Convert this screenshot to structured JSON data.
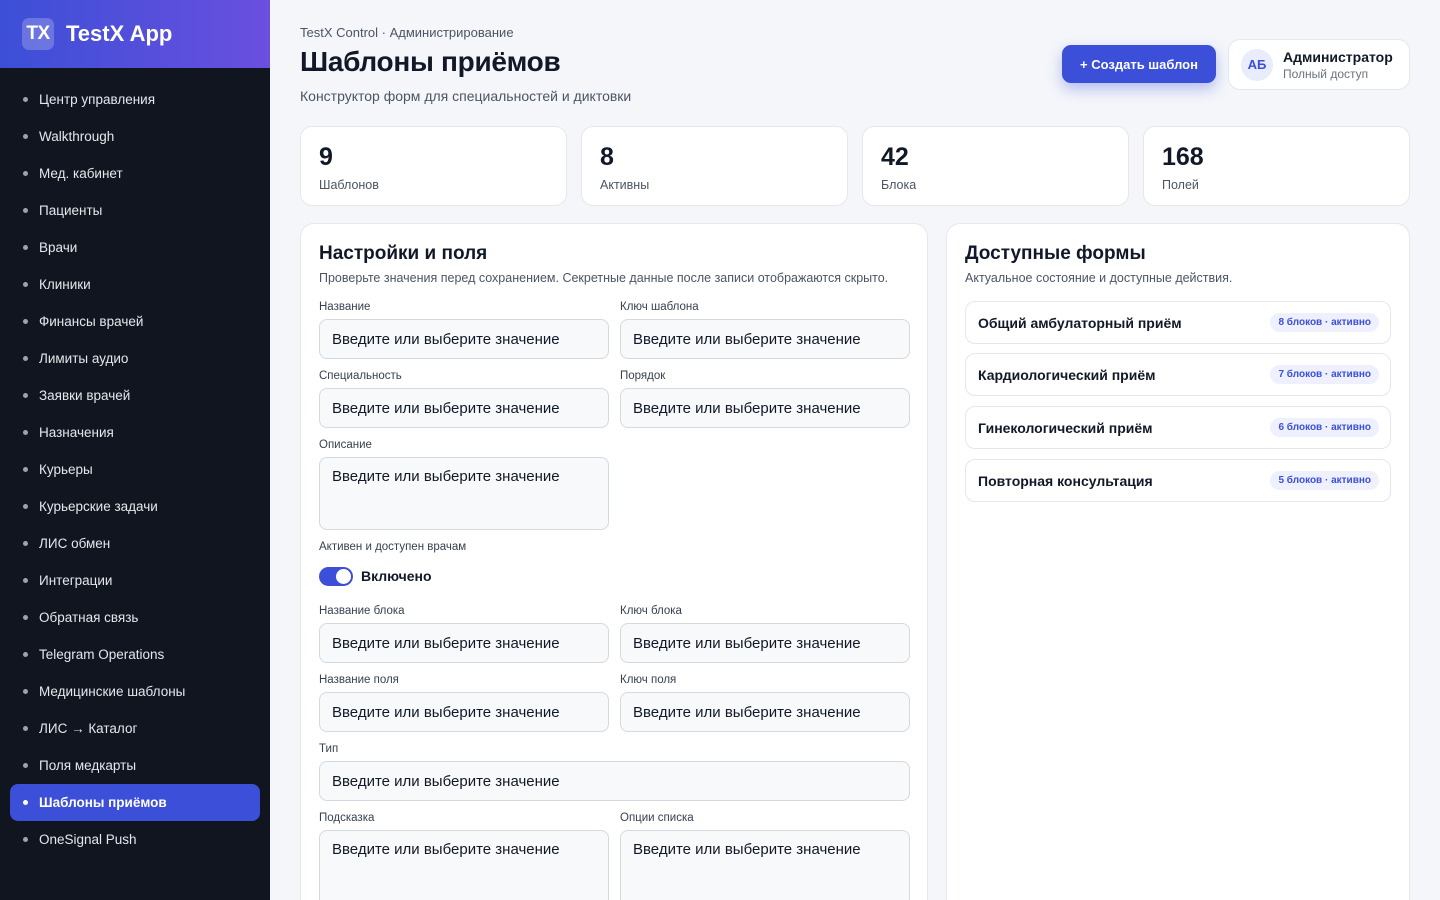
{
  "brand": {
    "logo": "TX",
    "name": "TestX App"
  },
  "sidebar": {
    "items": [
      {
        "label": "Центр управления",
        "active": false
      },
      {
        "label": "Walkthrough",
        "active": false
      },
      {
        "label": "Мед. кабинет",
        "active": false
      },
      {
        "label": "Пациенты",
        "active": false
      },
      {
        "label": "Врачи",
        "active": false
      },
      {
        "label": "Клиники",
        "active": false
      },
      {
        "label": "Финансы врачей",
        "active": false
      },
      {
        "label": "Лимиты аудио",
        "active": false
      },
      {
        "label": "Заявки врачей",
        "active": false
      },
      {
        "label": "Назначения",
        "active": false
      },
      {
        "label": "Курьеры",
        "active": false
      },
      {
        "label": "Курьерские задачи",
        "active": false
      },
      {
        "label": "ЛИС обмен",
        "active": false
      },
      {
        "label": "Интеграции",
        "active": false
      },
      {
        "label": "Обратная связь",
        "active": false
      },
      {
        "label": "Telegram Operations",
        "active": false
      },
      {
        "label": "Медицинские шаблоны",
        "active": false
      },
      {
        "label": "ЛИС → Каталог",
        "active": false
      },
      {
        "label": "Поля медкарты",
        "active": false
      },
      {
        "label": "Шаблоны приёмов",
        "active": true
      },
      {
        "label": "OneSignal Push",
        "active": false
      }
    ]
  },
  "header": {
    "breadcrumb": "TestX Control · Администрирование",
    "title": "Шаблоны приёмов",
    "subtitle": "Конструктор форм для специальностей и диктовки",
    "create_button": "+ Создать шаблон"
  },
  "user": {
    "initials": "АБ",
    "name": "Администратор",
    "role": "Полный доступ"
  },
  "stats": [
    {
      "value": "9",
      "label": "Шаблонов"
    },
    {
      "value": "8",
      "label": "Активны"
    },
    {
      "value": "42",
      "label": "Блока"
    },
    {
      "value": "168",
      "label": "Полей"
    }
  ],
  "settings": {
    "title": "Настройки и поля",
    "description": "Проверьте значения перед сохранением. Секретные данные после записи отображаются скрыто.",
    "placeholder": "Введите или выберите значение",
    "labels": {
      "name": "Название",
      "template_key": "Ключ шаблона",
      "specialty": "Специальность",
      "order": "Порядок",
      "description": "Описание",
      "active": "Активен и доступен врачам",
      "block_name": "Название блока",
      "block_key": "Ключ блока",
      "field_name": "Название поля",
      "field_key": "Ключ поля",
      "type": "Тип",
      "hint": "Подсказка",
      "list_options": "Опции списка"
    },
    "toggle": {
      "on": true,
      "label": "Включено"
    }
  },
  "forms": {
    "title": "Доступные формы",
    "description": "Актуальное состояние и доступные действия.",
    "items": [
      {
        "name": "Общий амбулаторный приём",
        "badge": "8 блоков · активно"
      },
      {
        "name": "Кардиологический приём",
        "badge": "7 блоков · активно"
      },
      {
        "name": "Гинекологический приём",
        "badge": "6 блоков · активно"
      },
      {
        "name": "Повторная консультация",
        "badge": "5 блоков · активно"
      }
    ]
  },
  "colors": {
    "accent": "#3b4fd8",
    "sidebar_bg": "#111520",
    "page_bg": "#f4f6fa"
  }
}
